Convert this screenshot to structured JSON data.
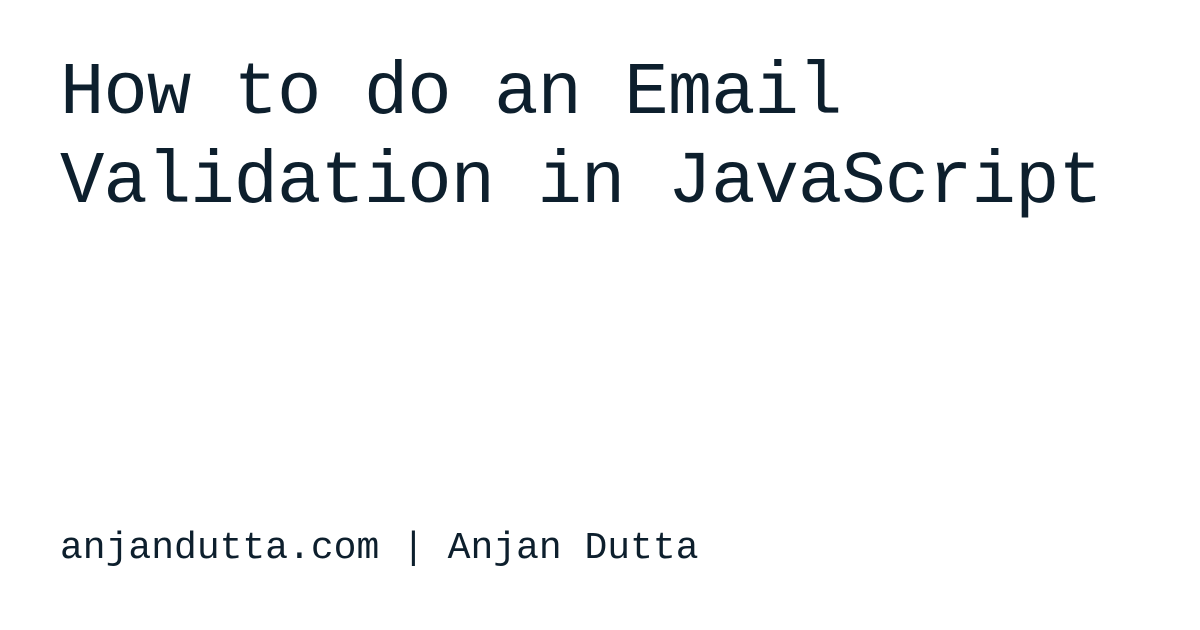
{
  "title": "How to do an Email Validation in JavaScript",
  "byline": "anjandutta.com | Anjan Dutta"
}
